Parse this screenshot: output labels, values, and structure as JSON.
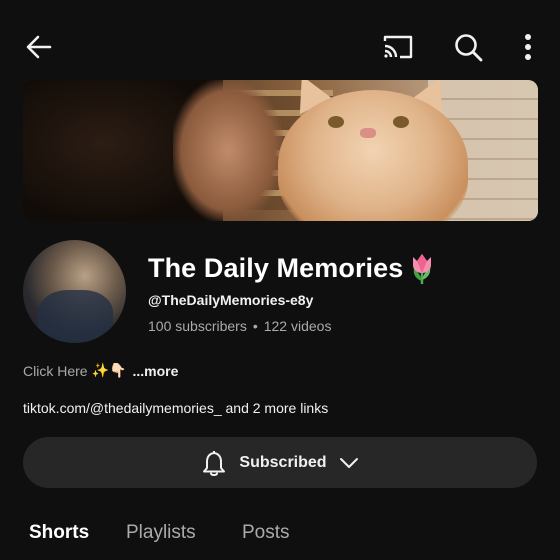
{
  "header": {
    "back_icon": "back-arrow-icon",
    "cast_icon": "cast-icon",
    "search_icon": "search-icon",
    "more_icon": "more-vertical-icon"
  },
  "channel": {
    "name": "The Daily Memories",
    "name_emoji": "tulip",
    "handle": "@TheDailyMemories-e8y",
    "subscribers": "100 subscribers",
    "separator": "•",
    "videos": "122 videos"
  },
  "description": {
    "text": "Click Here",
    "emojis": "✨👇🏻",
    "more_label": "...more"
  },
  "links": {
    "text": "tiktok.com/@thedailymemories_ and 2 more links"
  },
  "subscribe_button": {
    "label": "Subscribed",
    "bell_icon": "bell-icon",
    "chevron_icon": "chevron-down-icon"
  },
  "tabs": [
    {
      "label": "Shorts",
      "active": true
    },
    {
      "label": "Playlists",
      "active": false
    },
    {
      "label": "Posts",
      "active": false
    }
  ],
  "colors": {
    "background": "#0f0f0f",
    "button_bg": "#272727",
    "text_primary": "#f1f1f1",
    "text_secondary": "#aaaaaa"
  }
}
